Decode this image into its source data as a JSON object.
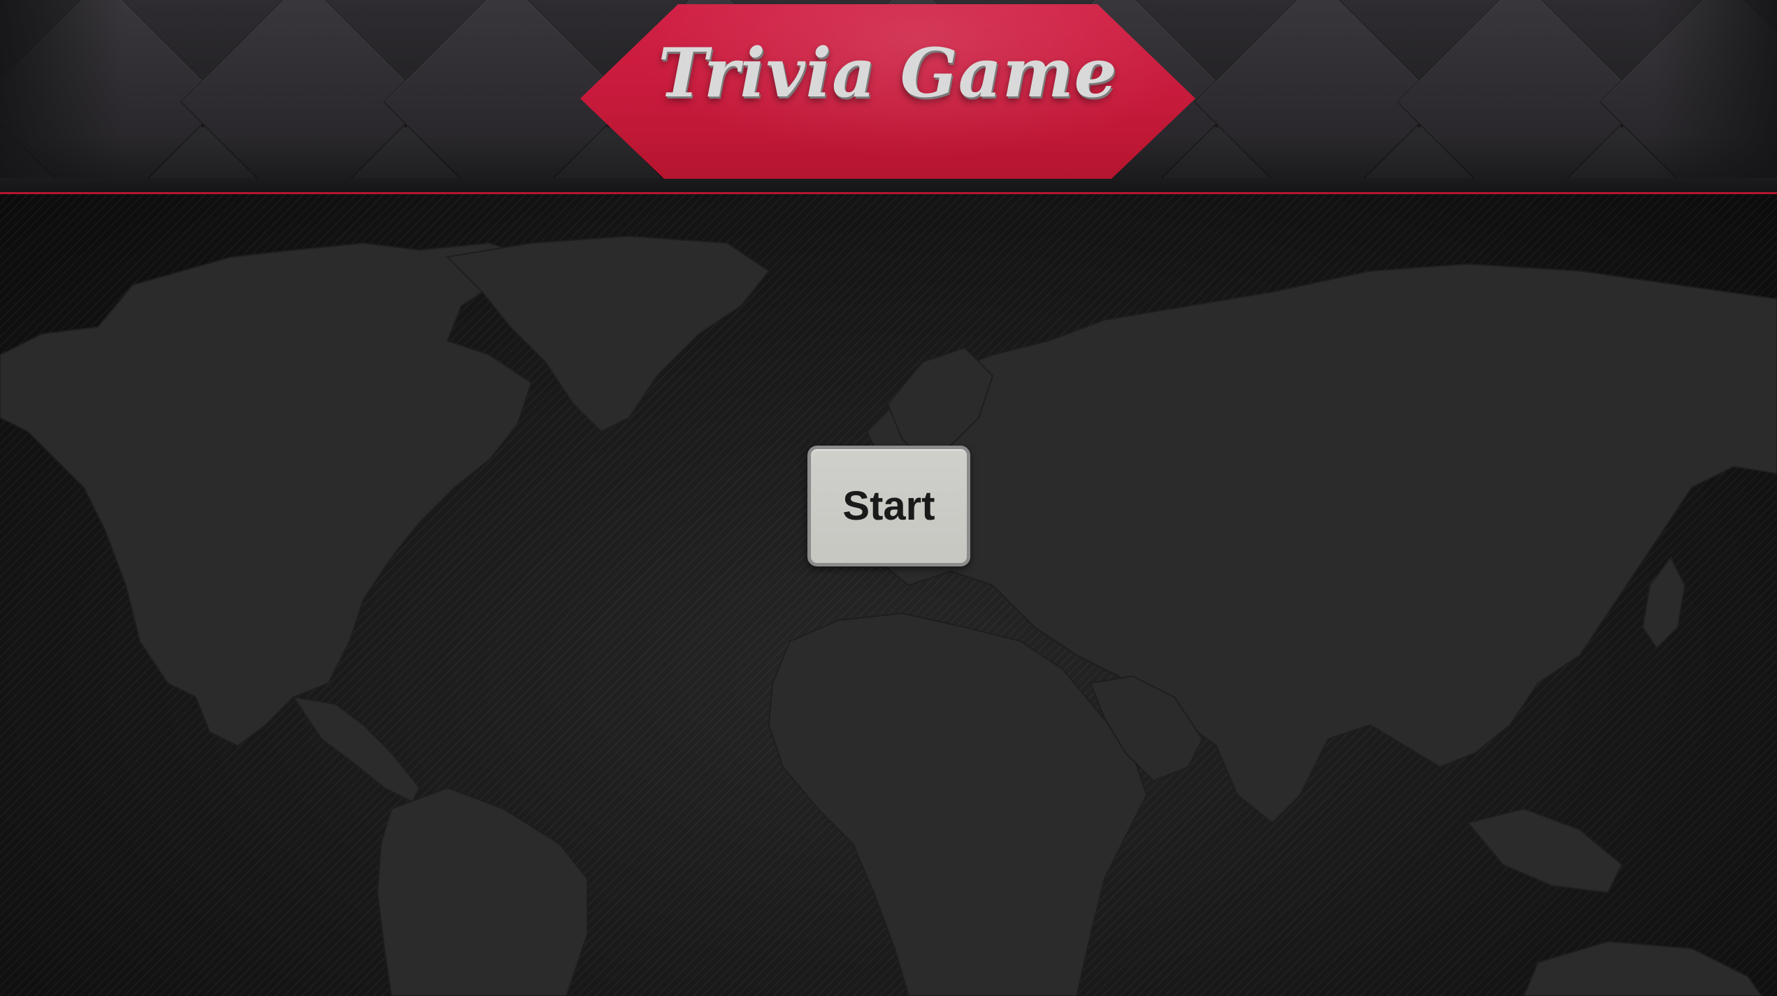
{
  "game": {
    "title": "Trivia Game",
    "start_label": "Start"
  },
  "theme": {
    "banner_color": "#c71a3b",
    "background_color": "#141414",
    "button_color": "#c9cac4",
    "accent_line_color": "#b3182f"
  },
  "background": {
    "header_pattern": "diamond-tile-icon",
    "main_pattern": "world-map-icon"
  }
}
